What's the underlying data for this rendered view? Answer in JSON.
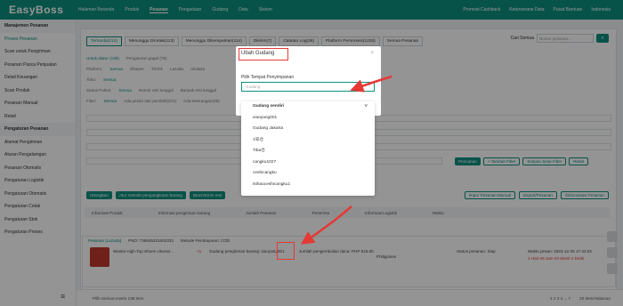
{
  "app": {
    "logo": "EasyBoss",
    "topnav": [
      "Halaman Beranda",
      "Produk",
      "Pesanan",
      "Pengadaan",
      "Gudang",
      "Data",
      "Sistem"
    ],
    "topnav_active": 2,
    "topright": [
      "Promosi Cashback",
      "Keterserane Data",
      "Pusat Bantuan",
      "Indonesia"
    ]
  },
  "sidebar": {
    "items": [
      {
        "label": "Manajemen Pesanan",
        "group": true
      },
      {
        "label": "Proses Pesanan",
        "active": true
      },
      {
        "label": "Scan untuk Pengiriman"
      },
      {
        "label": "Pesanan Pasca Penjualan"
      },
      {
        "label": "Detail Keuangan"
      },
      {
        "label": "Scan Produk"
      },
      {
        "label": "Pesanan Manual"
      },
      {
        "label": "Retail"
      },
      {
        "label": "Pengaturan Pesanan",
        "group": true
      },
      {
        "label": "Alamat Pengiriman"
      },
      {
        "label": "Aturan Pengalamgan"
      },
      {
        "label": "Pesanan Otomatis"
      },
      {
        "label": "Pengaturan Logistik"
      },
      {
        "label": "Pengaturan Otomatis"
      },
      {
        "label": "Pengaturan Cetak"
      },
      {
        "label": "Pengaturan Stok"
      },
      {
        "label": "Pengaturan Proses"
      }
    ]
  },
  "tabs": [
    "Tertunda(212)",
    "Menunggu Dicetak(113)",
    "Menunggu Dikemparkan(114)",
    "Dikirim(7)",
    "Catatan Log(26)",
    "Platform Pemrosesi(1226)",
    "Semua Pesanan"
  ],
  "search": {
    "label": "Cari Semua",
    "placeholder": "Nomor pesanan..."
  },
  "filters": {
    "row1_label": "Untuk diatur (136)",
    "row1_other": "Pengaturan gagal (75)",
    "platform_label": "Platform:",
    "platform_values": [
      "Semua",
      "Shopee",
      "TikTok",
      "Lazada",
      "Akulaku"
    ],
    "toko_label": "Toko:",
    "toko_value": "Semua",
    "status_label": "Status Pulsat:",
    "status_values": [
      "Semua",
      "Nomor resi tunggal",
      "Banyak resi tunggal"
    ],
    "filter_label": "Filter:",
    "filter_values": [
      "Semua",
      "Ada pesan dari pembeli(331)",
      "Ada keterangan(99)"
    ]
  },
  "buttons": {
    "pencarian": "Pencarian",
    "tambah_filter": "+ Tambah Filter",
    "simpan_filter": "Simpan Sese Filter",
    "reset": "Reset",
    "action1": "Ubungkan",
    "action2": "Atur metode pengangkutan barang",
    "action3": "Batch/Kirim resi",
    "action4": "Impor Pesanan Manual",
    "action5": "Export/Pesanan",
    "action6": "Sinkronisasi Pesanan"
  },
  "table_head": [
    "Informasi Produk",
    "Informasi pengiriman barang",
    "Jumlah Pesanan",
    "Penerima",
    "Informasi Logistik",
    "Waktu"
  ],
  "modal": {
    "title": "Ubah Gudang",
    "close": "×",
    "field_label": "Pilih Tempat Penyimpanan",
    "select_placeholder": "Gudang",
    "options": [
      "Gudang sendiri",
      "xiaoyang001",
      "Gudang Jakarta",
      "1号仓",
      "Tiba仓",
      "cangku1027",
      "ceshicangku",
      "tsihaoceshicangku1"
    ]
  },
  "order": {
    "store": "Pesanan [Lazada]",
    "pno": "PNO: 739845321602333",
    "method": "Metode Pembayaran: COD",
    "product_title": "Wanita High-Top Shoes Ukuran...",
    "qty": "×1",
    "warehouse_line": "Gudang pengiriman barang: xiaoyang001",
    "amount": "Jumlah pengembalian dana: PHP 519.00",
    "region": "Philippines",
    "status": "Status pesanan: Siap",
    "time": "Waktu pesan: 2023-12-26 17:44:03",
    "deadline": "1 Hari 06 Jam 04 Menit 4 Detik"
  },
  "pagination": {
    "left": "Pilih Semua  Invers  138 Item",
    "pages": "1 2 3 4 ... 7",
    "per_page": "20 Item/Halaman"
  }
}
